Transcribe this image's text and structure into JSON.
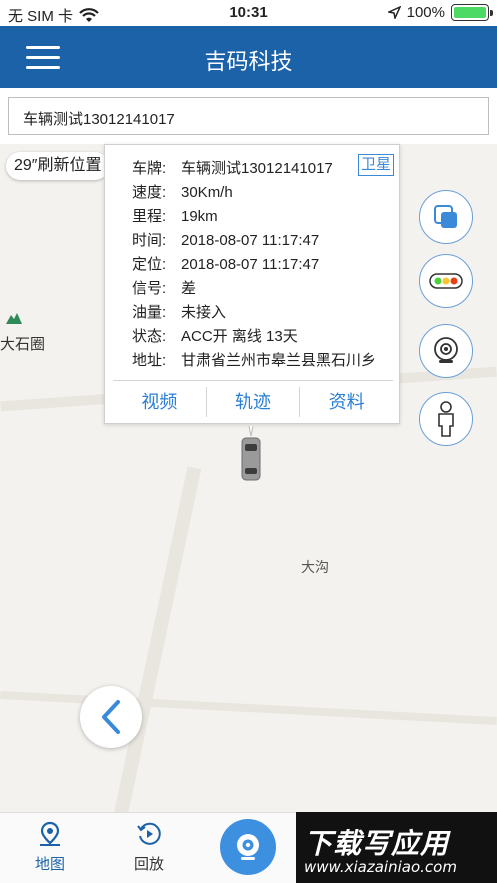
{
  "status_bar": {
    "carrier": "无 SIM 卡",
    "time": "10:31",
    "battery": "100%"
  },
  "nav": {
    "title": "吉码科技"
  },
  "search": {
    "value": "车辆测试13012141017"
  },
  "map": {
    "refresh": "29″刷新位置",
    "place_left": "大石圈",
    "place_right": "大沟"
  },
  "info_card": {
    "satellite": "卫星",
    "rows": [
      {
        "key": "车牌:",
        "value": "车辆测试13012141017"
      },
      {
        "key": "速度:",
        "value": "30Km/h"
      },
      {
        "key": "里程:",
        "value": "19km"
      },
      {
        "key": "时间:",
        "value": "2018-08-07 11:17:47"
      },
      {
        "key": "定位:",
        "value": "2018-08-07 11:17:47"
      },
      {
        "key": "信号:",
        "value": "差"
      },
      {
        "key": "油量:",
        "value": "未接入"
      },
      {
        "key": "状态:",
        "value": "ACC开 离线 13天"
      },
      {
        "key": "地址:",
        "value": "甘肃省兰州市皋兰县黑石川乡"
      }
    ],
    "actions": [
      "视频",
      "轨迹",
      "资料"
    ]
  },
  "tabs": [
    {
      "label": "地图"
    },
    {
      "label": "回放"
    }
  ],
  "watermark": {
    "top": "下载写应用",
    "bottom": "www.xiazainiao.com"
  },
  "colors": {
    "brand": "#1b62a8",
    "accent": "#3b8ad9"
  }
}
